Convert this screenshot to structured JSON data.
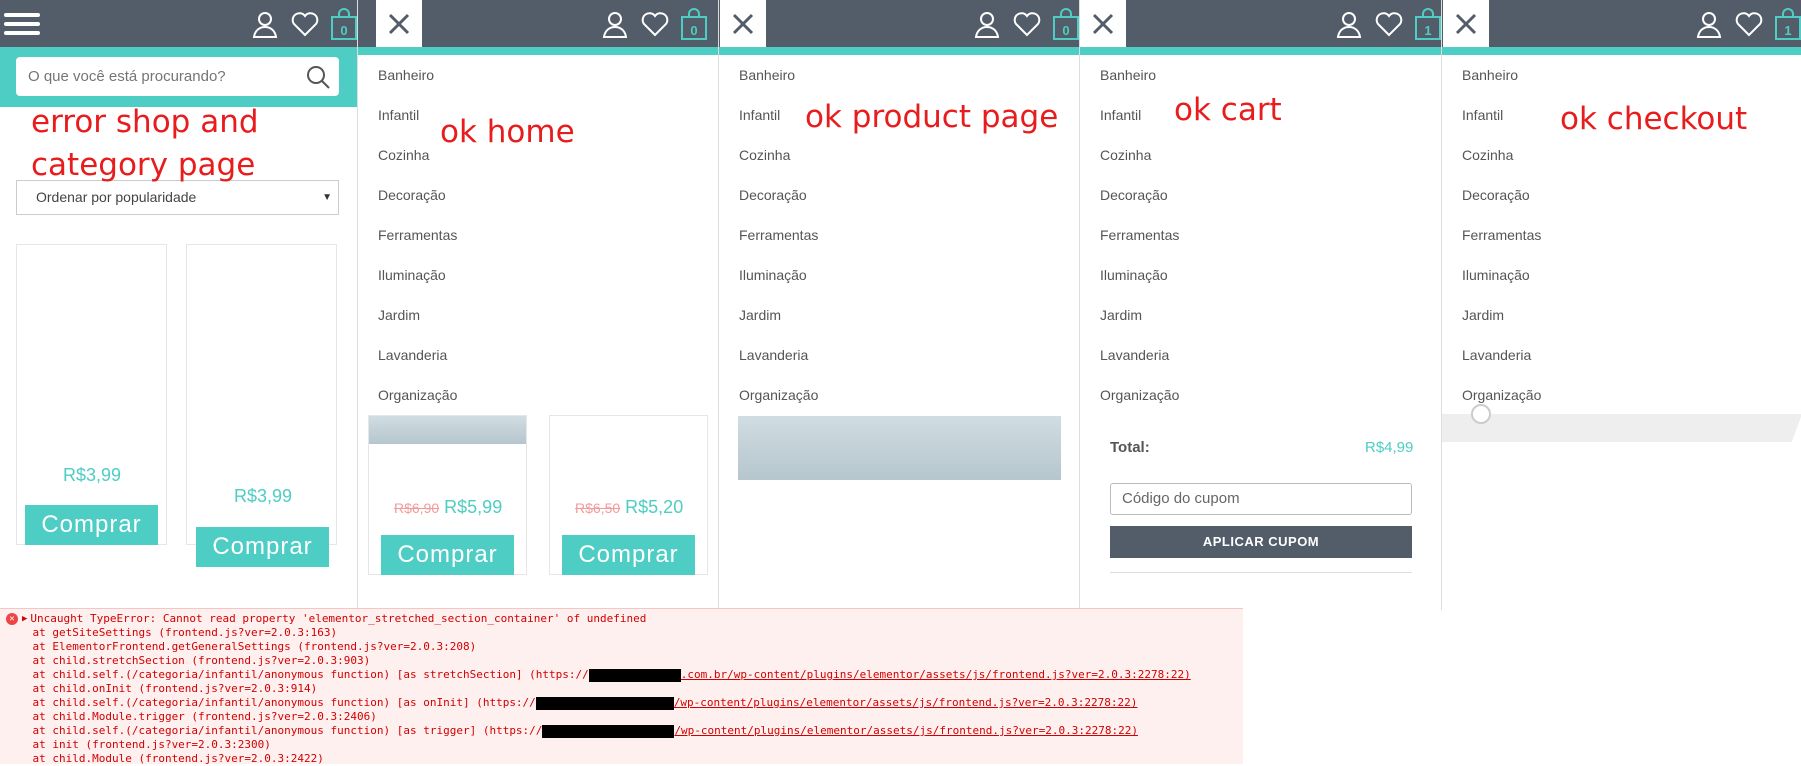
{
  "panels": [
    {
      "id": "shop",
      "cart_count": "0",
      "note": "error shop and\ncategory page"
    },
    {
      "id": "home",
      "cart_count": "0",
      "note": "ok home"
    },
    {
      "id": "product",
      "cart_count": "0",
      "note": "ok product page"
    },
    {
      "id": "cart",
      "cart_count": "1",
      "note": "ok cart"
    },
    {
      "id": "checkout",
      "cart_count": "1",
      "note": "ok checkout"
    }
  ],
  "search": {
    "placeholder": "O que você está procurando?"
  },
  "sort": {
    "selected": "Ordenar por popularidade"
  },
  "menu": [
    "Banheiro",
    "Infantil",
    "Cozinha",
    "Decoração",
    "Ferramentas",
    "Iluminação",
    "Jardim",
    "Lavanderia",
    "Organização"
  ],
  "shop_products": [
    {
      "price": "R$3,99",
      "button": "Comprar"
    },
    {
      "price": "R$3,99",
      "button": "Comprar"
    }
  ],
  "home_products": [
    {
      "old_price": "R$6,90",
      "price": "R$5,99",
      "button": "Comprar"
    },
    {
      "old_price": "R$6,50",
      "price": "R$5,20",
      "button": "Comprar"
    }
  ],
  "cart": {
    "total_label": "Total:",
    "total_value": "R$4,99",
    "coupon_placeholder": "Código do cupom",
    "apply_label": "APLICAR CUPOM"
  },
  "console": {
    "lines": [
      "Uncaught TypeError: Cannot read property 'elementor_stretched_section_container' of undefined",
      "    at getSiteSettings (frontend.js?ver=2.0.3:163)",
      "    at ElementorFrontend.getGeneralSettings (frontend.js?ver=2.0.3:208)",
      "    at child.stretchSection (frontend.js?ver=2.0.3:903)",
      "    at child.self.(/categoria/infantil/anonymous function) [as stretchSection] (https://",
      "    at child.onInit (frontend.js?ver=2.0.3:914)",
      "    at child.self.(/categoria/infantil/anonymous function) [as onInit] (https://",
      "    at child.Module.trigger (frontend.js?ver=2.0.3:2406)",
      "    at child.self.(/categoria/infantil/anonymous function) [as trigger] (https://",
      "    at init (frontend.js?ver=2.0.3:2300)",
      "    at child.Module (frontend.js?ver=2.0.3:2422)"
    ],
    "url_tails": [
      ".com.br/wp-content/plugins/elementor/assets/js/frontend.js?ver=2.0.3:2278:22)",
      "/wp-content/plugins/elementor/assets/js/frontend.js?ver=2.0.3:2278:22)",
      "/wp-content/plugins/elementor/assets/js/frontend.js?ver=2.0.3:2278:22)"
    ]
  },
  "colors": {
    "header": "#535c69",
    "accent": "#4ecdc4",
    "note": "#e81c1c"
  }
}
